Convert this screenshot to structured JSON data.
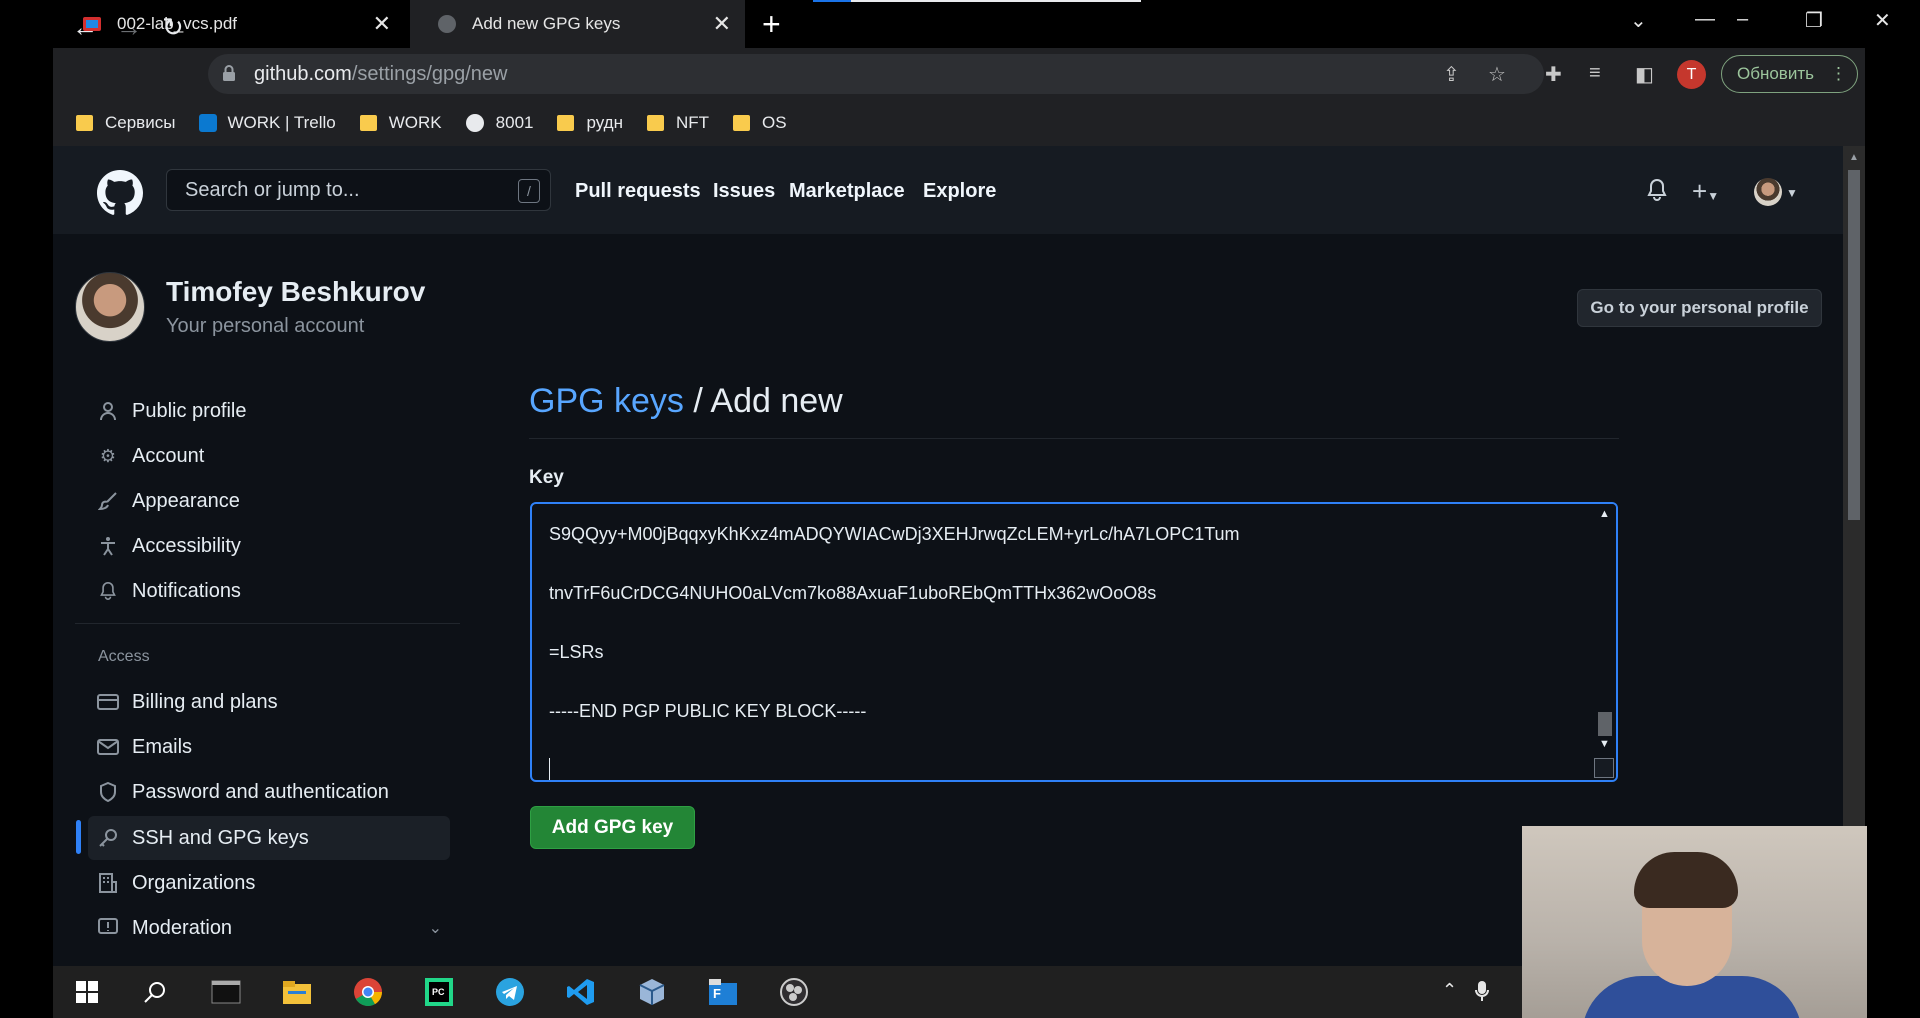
{
  "browser": {
    "tabs": [
      {
        "label": "002-lab_vcs.pdf",
        "active": false
      },
      {
        "label": "Add new GPG keys",
        "active": true
      }
    ],
    "url_host": "github.com",
    "url_path": "/settings/gpg/new",
    "profile_initial": "T",
    "update_label": "Обновить",
    "bookmarks": [
      {
        "label": "Сервисы",
        "icon": "folder-icon"
      },
      {
        "label": "WORK | Trello",
        "icon": "trello-icon"
      },
      {
        "label": "WORK",
        "icon": "folder-icon"
      },
      {
        "label": "8001",
        "icon": "globe-icon"
      },
      {
        "label": "рудн",
        "icon": "folder-icon"
      },
      {
        "label": "NFT",
        "icon": "folder-icon"
      },
      {
        "label": "OS",
        "icon": "folder-icon"
      }
    ]
  },
  "github": {
    "search_placeholder": "Search or jump to...",
    "search_shortcut": "/",
    "nav": [
      "Pull requests",
      "Issues",
      "Marketplace",
      "Explore"
    ],
    "user_name": "Timofey Beshkurov",
    "user_subtitle": "Your personal account",
    "personal_profile_button": "Go to your personal profile",
    "sidebar": {
      "items": [
        {
          "label": "Public profile",
          "icon": "person-icon"
        },
        {
          "label": "Account",
          "icon": "gear-icon"
        },
        {
          "label": "Appearance",
          "icon": "paintbrush-icon"
        },
        {
          "label": "Accessibility",
          "icon": "accessibility-icon"
        },
        {
          "label": "Notifications",
          "icon": "bell-icon"
        }
      ],
      "section_access": "Access",
      "access_items": [
        {
          "label": "Billing and plans",
          "icon": "credit-card-icon"
        },
        {
          "label": "Emails",
          "icon": "mail-icon"
        },
        {
          "label": "Password and authentication",
          "icon": "shield-icon"
        },
        {
          "label": "SSH and GPG keys",
          "icon": "key-icon",
          "active": true
        },
        {
          "label": "Organizations",
          "icon": "organization-icon"
        },
        {
          "label": "Moderation",
          "icon": "report-icon"
        }
      ]
    },
    "page_title_link": "GPG keys",
    "page_title_rest": " / Add new",
    "key_label": "Key",
    "key_lines": [
      "S9QQyy+M00jBqqxyKhKxz4mADQYWIACwDj3XEHJrwqZcLEM+yrLc/hA7LOPC1Tum",
      "tnvTrF6uCrDCG4NUHO0aLVcm7ko88AxuaF1uboREbQmTTHx362wOoO8s",
      "=LSRs",
      "-----END PGP PUBLIC KEY BLOCK-----"
    ],
    "add_button": "Add GPG key"
  },
  "taskbar": {
    "apps": [
      "windows-start-icon",
      "search-icon",
      "terminal-icon",
      "file-explorer-icon",
      "chrome-icon",
      "pycharm-icon",
      "telegram-icon",
      "vscode-icon",
      "virtualbox-icon",
      "far-manager-icon",
      "obs-icon"
    ]
  },
  "colors": {
    "accent": "#2f81f7",
    "link": "#58a6ff",
    "primary_button": "#238636",
    "page_bg": "#0d1117",
    "header_bg": "#161b22"
  }
}
